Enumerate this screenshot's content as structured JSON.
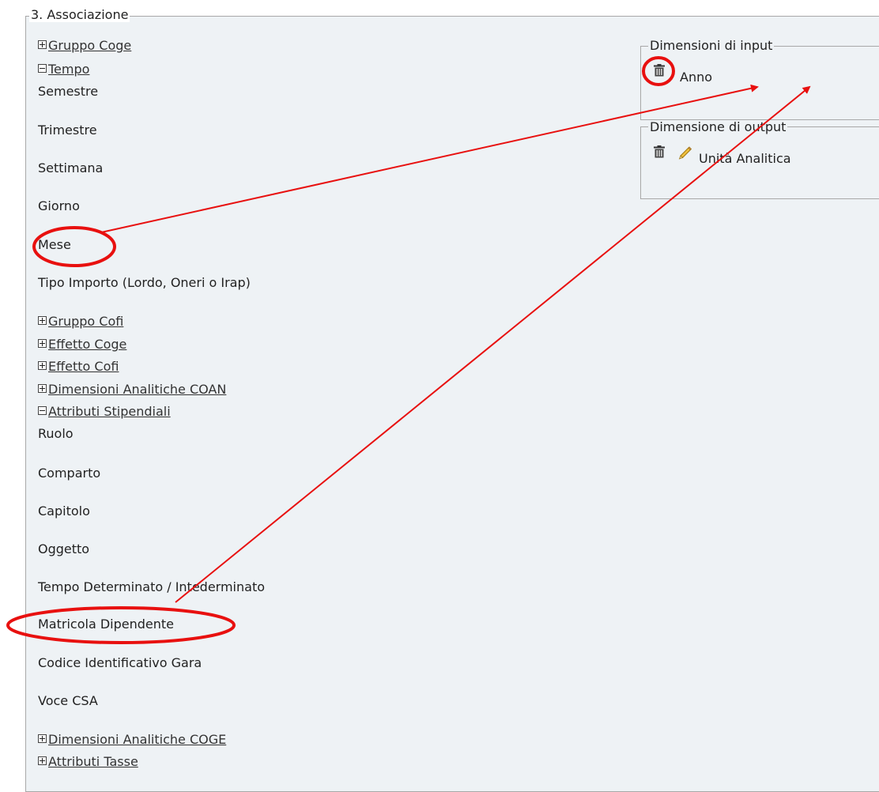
{
  "section_title": "3. Associazione",
  "tree": [
    {
      "type": "group",
      "state": "plus",
      "label": "Gruppo Coge"
    },
    {
      "type": "group",
      "state": "minus",
      "label": "Tempo"
    },
    {
      "type": "leaf",
      "label": "Semestre"
    },
    {
      "type": "leaf",
      "label": "Trimestre"
    },
    {
      "type": "leaf",
      "label": "Settimana"
    },
    {
      "type": "leaf",
      "label": "Giorno"
    },
    {
      "type": "leaf",
      "label": "Mese"
    },
    {
      "type": "leaf",
      "label": "Tipo Importo (Lordo, Oneri o Irap)"
    },
    {
      "type": "group",
      "state": "plus",
      "label": "Gruppo Cofi"
    },
    {
      "type": "group",
      "state": "plus",
      "label": "Effetto Coge"
    },
    {
      "type": "group",
      "state": "plus",
      "label": "Effetto Cofi"
    },
    {
      "type": "group",
      "state": "plus",
      "label": "Dimensioni Analitiche COAN"
    },
    {
      "type": "group",
      "state": "minus",
      "label": "Attributi Stipendiali"
    },
    {
      "type": "leaf",
      "label": "Ruolo"
    },
    {
      "type": "leaf",
      "label": "Comparto"
    },
    {
      "type": "leaf",
      "label": "Capitolo"
    },
    {
      "type": "leaf",
      "label": "Oggetto"
    },
    {
      "type": "leaf",
      "label": "Tempo Determinato / Intederminato"
    },
    {
      "type": "leaf",
      "label": "Matricola Dipendente"
    },
    {
      "type": "leaf",
      "label": "Codice Identificativo Gara"
    },
    {
      "type": "leaf",
      "label": "Voce CSA"
    },
    {
      "type": "group",
      "state": "plus",
      "label": "Dimensioni Analitiche COGE"
    },
    {
      "type": "group",
      "state": "plus",
      "label": "Attributi Tasse"
    }
  ],
  "input_box": {
    "legend": "Dimensioni di input",
    "items": [
      {
        "label": "Anno",
        "icons": [
          "trash-icon"
        ]
      }
    ]
  },
  "output_box": {
    "legend": "Dimensione di output",
    "items": [
      {
        "label": "Unità Analitica",
        "icons": [
          "trash-icon",
          "pencil-icon"
        ]
      }
    ]
  },
  "colors": {
    "panel_bg": "#eef2f5",
    "border": "#a8a8a8",
    "annotation": "#e8100f"
  }
}
